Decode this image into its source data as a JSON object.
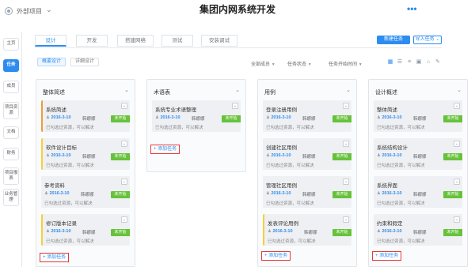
{
  "topbar": {
    "project_label": "外部项目",
    "title": "集团内网系统开发",
    "more": "•••"
  },
  "leftnav": [
    "主页",
    "任务",
    "成员",
    "项目资源",
    "文档",
    "财务",
    "项目报表",
    "业务管理"
  ],
  "tabs": [
    "设计",
    "开发",
    "搭建网络",
    "测试",
    "安装调试"
  ],
  "actions": {
    "new_task": "新建任务",
    "import_task": "导入任务"
  },
  "subtabs": [
    "概要设计",
    "详细设计"
  ],
  "filters": [
    "全部成员",
    "任务状态",
    "任务开始时间"
  ],
  "view_icons": [
    "board-view",
    "list-view",
    "gantt-view",
    "calendar-view",
    "attachment-view",
    "edit-view"
  ],
  "columns": [
    {
      "title": "整体简述",
      "cards": [
        {
          "title": "系统简述",
          "date": "2016-3-10",
          "owner": "韩娜娜",
          "badge": "未开始",
          "note": "已勾选过资源，可以解决",
          "accent": "orange"
        },
        {
          "title": "软件设计目标",
          "date": "2016-3-10",
          "owner": "韩娜娜",
          "badge": "未开始",
          "note": "已勾选过资源，可以解决",
          "accent": "yellow"
        },
        {
          "title": "参考资料",
          "date": "2016-3-10",
          "owner": "韩娜娜",
          "badge": "未开始",
          "note": "已勾选过资源，可以解决",
          "accent": "none"
        },
        {
          "title": "修订版本记录",
          "date": "2016-3-10",
          "owner": "韩娜娜",
          "badge": "未开始",
          "note": "已勾选过资源，可以解决",
          "accent": "yellow"
        }
      ],
      "add_label": "添加任务"
    },
    {
      "title": "术语表",
      "cards": [
        {
          "title": "系统专业术语整理",
          "date": "2016-3-10",
          "owner": "韩娜娜",
          "badge": "未开始",
          "note": "已勾选过资源，可以解决",
          "accent": "none"
        }
      ],
      "add_label": "添加任务"
    },
    {
      "title": "用例",
      "cards": [
        {
          "title": "登录注册用例",
          "date": "2016-3-10",
          "owner": "韩娜娜",
          "badge": "未开始",
          "note": "已勾选过资源，可以解决",
          "accent": "none"
        },
        {
          "title": "创建社区用例",
          "date": "2016-3-10",
          "owner": "韩娜娜",
          "badge": "未开始",
          "note": "已勾选过资源，可以解决",
          "accent": "none"
        },
        {
          "title": "管理社区用例",
          "date": "2016-3-10",
          "owner": "韩娜娜",
          "badge": "未开始",
          "note": "已勾选过资源，可以解决",
          "accent": "none"
        },
        {
          "title": "发表评论用例",
          "date": "2016-3-10",
          "owner": "韩娜娜",
          "badge": "未开始",
          "note": "已勾选过资源，可以解决",
          "accent": "yellow"
        }
      ],
      "add_label": "添加任务"
    },
    {
      "title": "设计概述",
      "cards": [
        {
          "title": "整体简述",
          "date": "2016-3-10",
          "owner": "韩娜娜",
          "badge": "未开始",
          "note": "已勾选过资源，可以解决",
          "accent": "none"
        },
        {
          "title": "系统结构设计",
          "date": "2016-3-10",
          "owner": "韩娜娜",
          "badge": "未开始",
          "note": "已勾选过资源，可以解决",
          "accent": "none"
        },
        {
          "title": "系统界面",
          "date": "2016-3-10",
          "owner": "韩娜娜",
          "badge": "未开始",
          "note": "已勾选过资源，可以解决",
          "accent": "none"
        },
        {
          "title": "约束和假定",
          "date": "2016-3-10",
          "owner": "韩娜娜",
          "badge": "未开始",
          "note": "已勾选过资源，可以解决",
          "accent": "none"
        }
      ],
      "add_label": "添加任务"
    }
  ]
}
